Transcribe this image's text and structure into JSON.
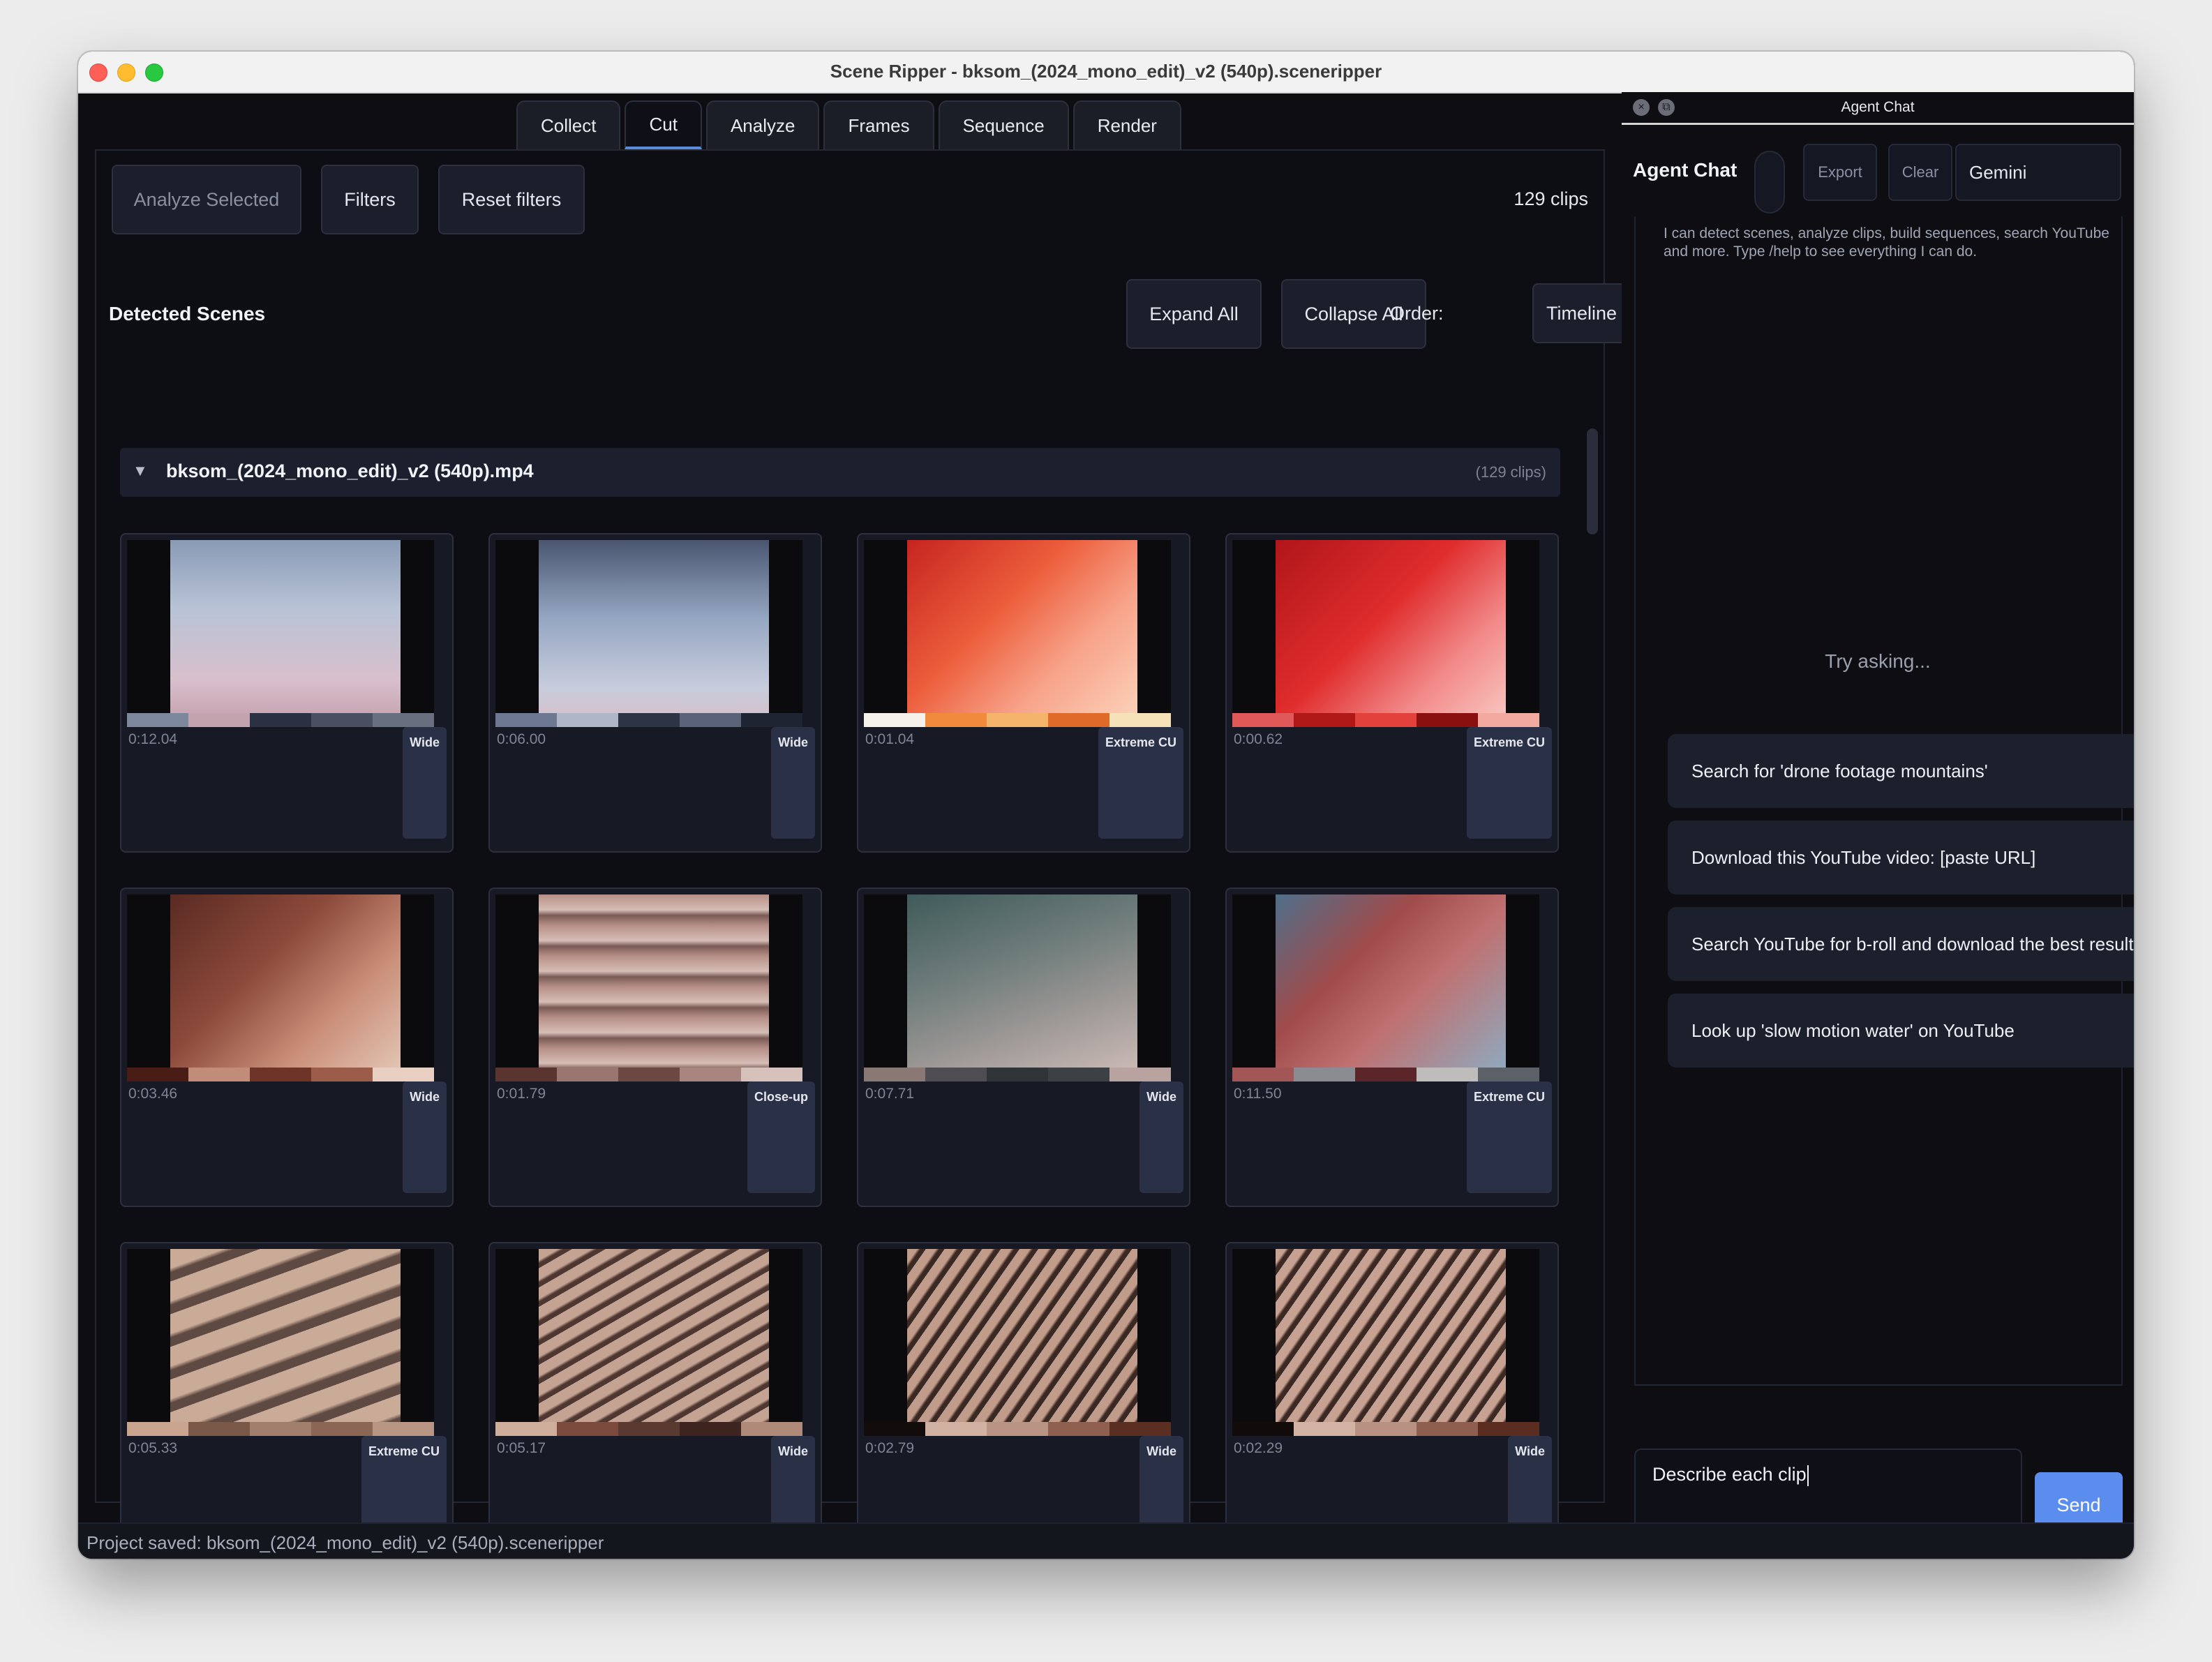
{
  "window": {
    "title": "Scene Ripper - bksom_(2024_mono_edit)_v2 (540p).sceneripper"
  },
  "tabs": [
    {
      "label": "Collect",
      "active": false
    },
    {
      "label": "Cut",
      "active": true
    },
    {
      "label": "Analyze",
      "active": false
    },
    {
      "label": "Frames",
      "active": false
    },
    {
      "label": "Sequence",
      "active": false
    },
    {
      "label": "Render",
      "active": false
    }
  ],
  "toolbar": {
    "analyze_selected": "Analyze Selected",
    "filters": "Filters",
    "reset_filters": "Reset filters",
    "clip_count": "129 clips"
  },
  "scenes": {
    "title": "Detected Scenes",
    "expand_all": "Expand All",
    "collapse_all": "Collapse All",
    "order_label": "Order:",
    "order_value": "Timeline",
    "group_arrow": "▼",
    "group_name": "bksom_(2024_mono_edit)_v2 (540p).mp4",
    "group_count": "(129 clips)"
  },
  "clips": [
    {
      "duration": "0:12.04",
      "shot": "Wide",
      "thumb": "linear-gradient(180deg,#8a9bb6 0%,#b8c3d6 40%,#d8c0cc 80%,#c9a7b5 100%)",
      "palette": [
        "#7d889d",
        "#c3a3ad",
        "#2b3142",
        "#4a5062",
        "#68707f"
      ]
    },
    {
      "duration": "0:06.00",
      "shot": "Wide",
      "thumb": "linear-gradient(180deg,#4a5670 0%,#95a6c2 45%,#c7ccdc 85%,#d3c3ce 100%)",
      "palette": [
        "#6d7892",
        "#aeb6c8",
        "#2d3446",
        "#5b6378",
        "#1f2433"
      ]
    },
    {
      "duration": "0:01.04",
      "shot": "Extreme CU",
      "thumb": "linear-gradient(135deg,#c6241f 0%,#ec5d3b 40%,#f7a48b 70%,#fbd0b8 100%)",
      "palette": [
        "#f6f1ea",
        "#f08a3c",
        "#f5b46c",
        "#e06a2a",
        "#f6e2b8"
      ]
    },
    {
      "duration": "0:00.62",
      "shot": "Extreme CU",
      "thumb": "linear-gradient(135deg,#b0161a 0%,#e02c2c 45%,#f28a8a 75%,#f7c3bd 100%)",
      "palette": [
        "#e05858",
        "#b01818",
        "#e2413c",
        "#8a1010",
        "#f1a9a0"
      ]
    },
    {
      "duration": "0:03.46",
      "shot": "Wide",
      "thumb": "linear-gradient(135deg,#5a2a22 0%,#8c4a3b 40%,#c98d77 70%,#e2c4b3 100%)",
      "palette": [
        "#4a1c16",
        "#c18d7a",
        "#6e3428",
        "#9c5c4a",
        "#e8cfc1"
      ]
    },
    {
      "duration": "0:01.79",
      "shot": "Close-up",
      "thumb": "repeating-linear-gradient(180deg,#b58e86 0px,#d6beb6 22px,#7a5a55 30px,#b58e86 44px)",
      "palette": [
        "#5a3530",
        "#9a7670",
        "#6c4842",
        "#a8857f",
        "#d7c1bb"
      ]
    },
    {
      "duration": "0:07.71",
      "shot": "Wide",
      "thumb": "linear-gradient(160deg,#3f5b5a 0%,#6f7d7b 40%,#9d9896 70%,#c9b9b4 100%)",
      "palette": [
        "#8a7874",
        "#4e4d52",
        "#2f3437",
        "#3b4144",
        "#b9a39f"
      ]
    },
    {
      "duration": "0:11.50",
      "shot": "Extreme CU",
      "thumb": "linear-gradient(135deg,#4f6f8a 0%,#a04b4b 35%,#c07070 60%,#8fa9bd 100%)",
      "palette": [
        "#a35656",
        "#8a8c92",
        "#5a2629",
        "#bfbcbc",
        "#5c6168"
      ]
    },
    {
      "duration": "0:05.33",
      "shot": "Extreme CU",
      "thumb": "repeating-linear-gradient(160deg,#c9ab98 0px,#c9ab98 26px,#5e4a42 32px,#5e4a42 44px)",
      "palette": [
        "#c9a48f",
        "#7a5848",
        "#a27e6c",
        "#8b6654",
        "#b99683"
      ]
    },
    {
      "duration": "0:05.17",
      "shot": "Wide",
      "thumb": "repeating-linear-gradient(150deg,#c4a393 0px,#c4a393 14px,#4e3731 18px,#4e3731 24px)",
      "palette": [
        "#cfae9c",
        "#7b4a3c",
        "#5a3a30",
        "#3e241e",
        "#b08a78"
      ]
    },
    {
      "duration": "0:02.79",
      "shot": "Wide",
      "thumb": "repeating-linear-gradient(125deg,#c19c8b 0px,#c19c8b 12px,#3a2823 16px,#3a2823 22px)",
      "palette": [
        "#120c0b",
        "#d1b2a2",
        "#b99384",
        "#8f6050",
        "#5b2e22"
      ]
    },
    {
      "duration": "0:02.29",
      "shot": "Wide",
      "thumb": "repeating-linear-gradient(125deg,#c7a292 0px,#c7a292 12px,#3c2923 16px,#3c2923 22px)",
      "palette": [
        "#110b0a",
        "#d2b3a4",
        "#b89182",
        "#8e5f4f",
        "#5b2d21"
      ]
    }
  ],
  "chat": {
    "panel_title": "Agent Chat",
    "heading": "Agent Chat",
    "export": "Export",
    "clear": "Clear",
    "model": "Gemini",
    "intro_line1": "I can detect scenes, analyze clips, build sequences, search YouTube",
    "intro_line2": "and more. Type /help to see everything I can do.",
    "try_asking": "Try asking...",
    "suggestions": [
      "Search for 'drone footage mountains'",
      "Download this YouTube video: [paste URL]",
      "Search YouTube for b-roll and download the best results",
      "Look up 'slow motion water' on YouTube"
    ],
    "input_value": "Describe each clip",
    "send": "Send"
  },
  "status": {
    "text": "Project saved: bksom_(2024_mono_edit)_v2 (540p).sceneripper"
  }
}
